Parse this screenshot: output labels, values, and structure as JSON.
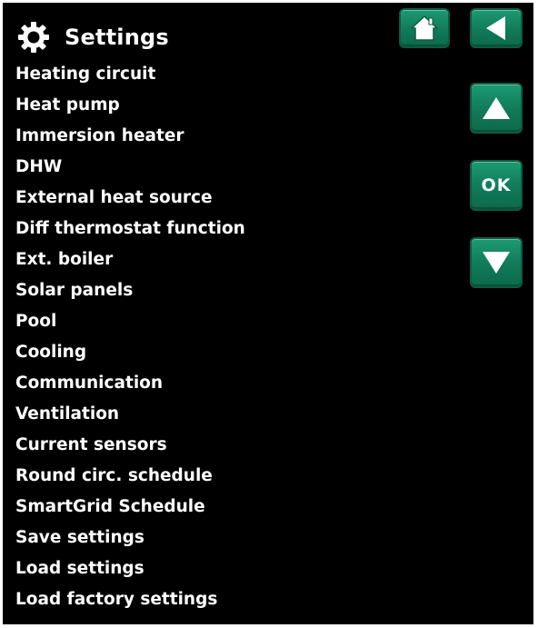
{
  "header": {
    "title": "Settings",
    "icon": "gear-icon"
  },
  "menu": {
    "items": [
      {
        "label": "Heating circuit"
      },
      {
        "label": "Heat pump"
      },
      {
        "label": "Immersion heater"
      },
      {
        "label": "DHW"
      },
      {
        "label": "External heat source"
      },
      {
        "label": "Diff thermostat function"
      },
      {
        "label": "Ext. boiler"
      },
      {
        "label": "Solar panels"
      },
      {
        "label": "Pool"
      },
      {
        "label": "Cooling"
      },
      {
        "label": "Communication"
      },
      {
        "label": "Ventilation"
      },
      {
        "label": "Current sensors"
      },
      {
        "label": "Round circ. schedule"
      },
      {
        "label": "SmartGrid Schedule"
      },
      {
        "label": "Save settings"
      },
      {
        "label": "Load settings"
      },
      {
        "label": "Load factory settings"
      }
    ]
  },
  "controls": {
    "home_icon": "home-icon",
    "back_icon": "back-arrow-icon",
    "up_icon": "arrow-up-icon",
    "ok_label": "OK",
    "down_icon": "arrow-down-icon"
  },
  "colors": {
    "background": "#000000",
    "text": "#ffffff",
    "button": "#15845f",
    "button_border": "#0e5a41"
  }
}
